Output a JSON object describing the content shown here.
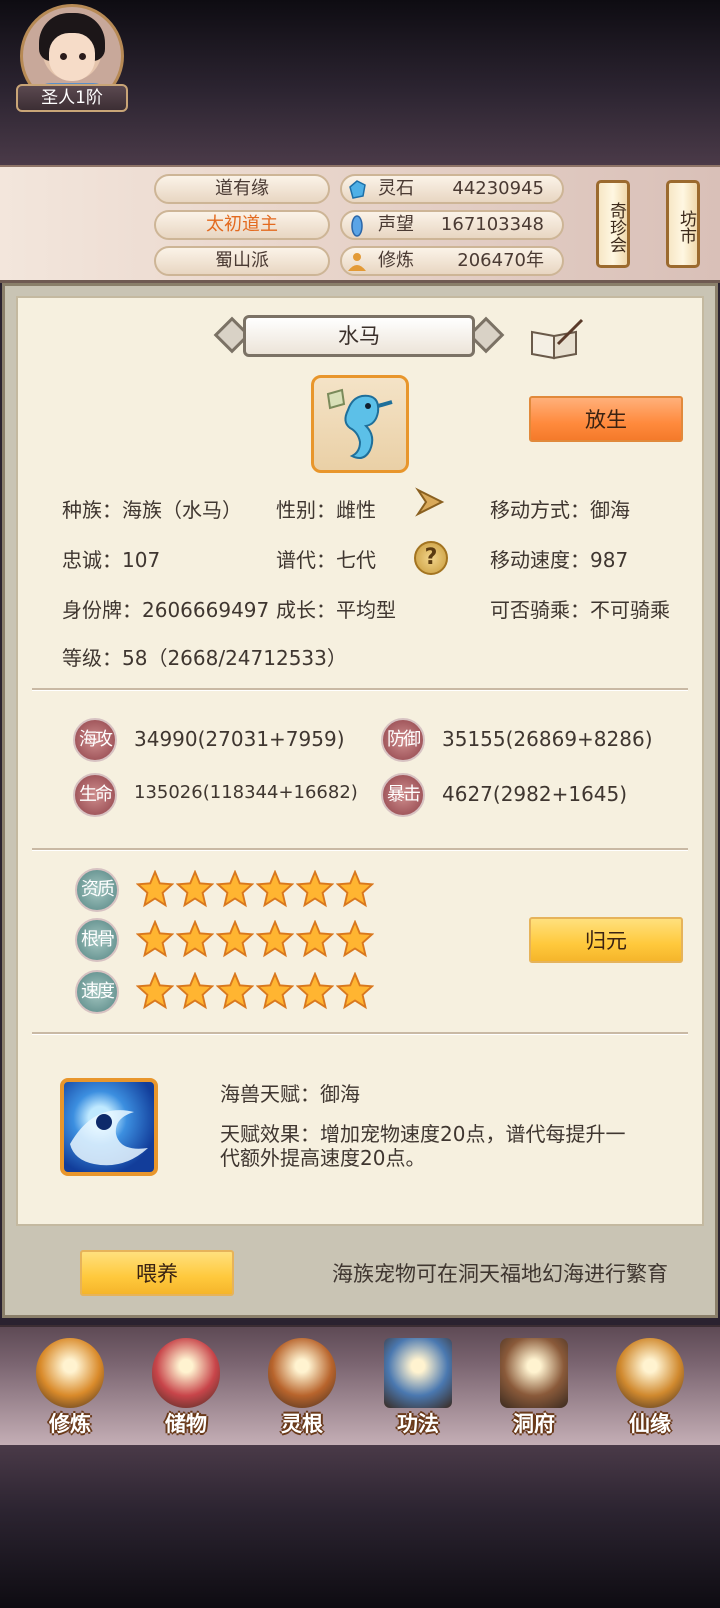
{
  "header": {
    "rank": "圣人1阶",
    "names": [
      "道有缘",
      "太初道主",
      "蜀山派"
    ],
    "stats": [
      {
        "icon": "spirit-stone-icon",
        "label": "灵石",
        "value": "44230945"
      },
      {
        "icon": "reputation-icon",
        "label": "声望",
        "value": "167103348"
      },
      {
        "icon": "cultivation-icon",
        "label": "修炼",
        "value": "206470年"
      }
    ],
    "scroll_buttons": [
      "奇珍会",
      "坊市"
    ]
  },
  "pet": {
    "title": "水马",
    "release_label": "放生",
    "info": {
      "race": "种族：海族（水马）",
      "gender": "性别：雌性",
      "move_type": "移动方式：御海",
      "loyalty": "忠诚：107",
      "generation": "谱代：七代",
      "move_speed": "移动速度：987",
      "id_tag": "身份牌：2606669497",
      "growth": "成长：平均型",
      "rideable": "可否骑乘：不可骑乘",
      "level": "等级：58（2668/24712533）"
    },
    "combat": [
      {
        "badge": "海攻",
        "value": "34990(27031+7959)"
      },
      {
        "badge": "防御",
        "value": "35155(26869+8286)"
      },
      {
        "badge": "生命",
        "value": "135026(118344+16682)"
      },
      {
        "badge": "暴击",
        "value": "4627(2982+1645)"
      }
    ],
    "aptitudes": [
      {
        "badge": "资质",
        "stars": 6
      },
      {
        "badge": "根骨",
        "stars": 6
      },
      {
        "badge": "速度",
        "stars": 6
      }
    ],
    "reset_label": "归元",
    "talent_name": "海兽天赋：御海",
    "talent_effect": "天赋效果：增加宠物速度20点，谱代每提升一代额外提高速度20点。",
    "feed_label": "喂养",
    "footer_note": "海族宠物可在洞天福地幻海进行繁育"
  },
  "nav": [
    {
      "label": "修炼",
      "icon": "meditation-icon",
      "color": "#d98a2a"
    },
    {
      "label": "储物",
      "icon": "storage-bag-icon",
      "color": "#c8454a"
    },
    {
      "label": "灵根",
      "icon": "spirit-root-icon",
      "color": "#b8642c"
    },
    {
      "label": "功法",
      "icon": "technique-book-icon",
      "color": "#4a78b0"
    },
    {
      "label": "洞府",
      "icon": "cave-mansion-icon",
      "color": "#8a5a3a"
    },
    {
      "label": "仙缘",
      "icon": "gourd-icon",
      "color": "#d0892e"
    }
  ]
}
